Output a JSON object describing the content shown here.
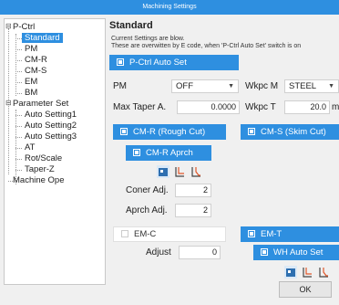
{
  "window": {
    "title": "Machining Settings"
  },
  "tree": {
    "items": [
      {
        "label": "P-Ctrl",
        "expander": "⊟"
      },
      {
        "label": "Standard"
      },
      {
        "label": "PM"
      },
      {
        "label": "CM-R"
      },
      {
        "label": "CM-S"
      },
      {
        "label": "EM"
      },
      {
        "label": "BM"
      },
      {
        "label": "Parameter Set",
        "expander": "⊟"
      },
      {
        "label": "Auto Setting1"
      },
      {
        "label": "Auto Setting2"
      },
      {
        "label": "Auto Setting3"
      },
      {
        "label": "AT"
      },
      {
        "label": "Rot/Scale"
      },
      {
        "label": "Taper-Z"
      },
      {
        "label": "Machine Ope"
      }
    ]
  },
  "main": {
    "title": "Standard",
    "desc_line1": "Current Settings are blow.",
    "desc_line2": "These are overwitten by E code, when 'P-Ctrl Auto Set' switch is on",
    "pctrl_auto_set": "P-Ctrl Auto Set",
    "pm_label": "PM",
    "pm_value": "OFF",
    "wkpc_m_label": "Wkpc M",
    "wkpc_m_value": "STEEL",
    "max_taper_label": "Max Taper A.",
    "max_taper_value": "0.0000",
    "wkpc_t_label": "Wkpc T",
    "wkpc_t_value": "20.0",
    "wkpc_t_unit": "m",
    "cmr_label": "CM-R (Rough Cut)",
    "cms_label": "CM-S (Skim Cut)",
    "cmr_aprch_label": "CM-R Aprch",
    "coner_adj_label": "Coner Adj.",
    "coner_adj_value": "2",
    "aprch_adj_label": "Aprch Adj.",
    "aprch_adj_value": "2",
    "emc_label": "EM-C",
    "adjust_label": "Adjust",
    "adjust_value": "0",
    "emt_label": "EM-T",
    "wh_auto_set_label": "WH Auto Set",
    "ok_label": "OK"
  },
  "colors": {
    "accent": "#2e8fe0",
    "title_bar": "#2e8fe0"
  }
}
